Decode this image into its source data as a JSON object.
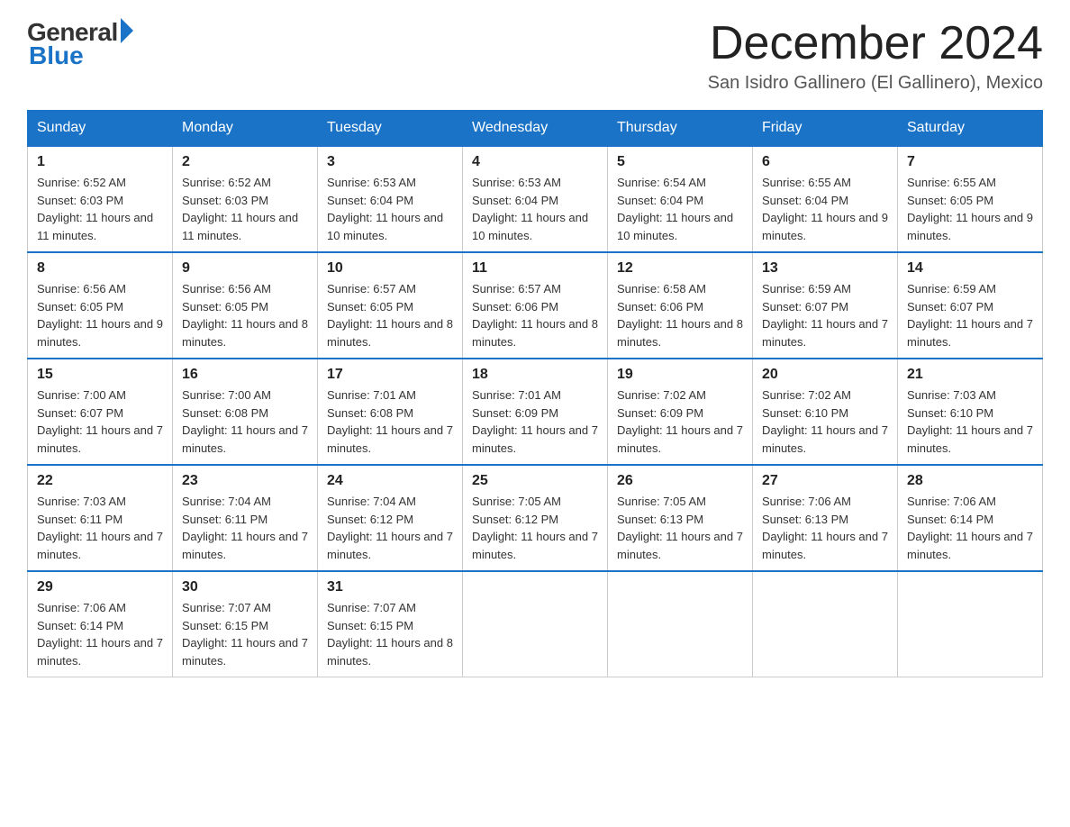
{
  "header": {
    "logo_general": "General",
    "logo_blue": "Blue",
    "month_year": "December 2024",
    "location": "San Isidro Gallinero (El Gallinero), Mexico"
  },
  "days_of_week": [
    "Sunday",
    "Monday",
    "Tuesday",
    "Wednesday",
    "Thursday",
    "Friday",
    "Saturday"
  ],
  "weeks": [
    [
      {
        "day": "1",
        "sunrise": "6:52 AM",
        "sunset": "6:03 PM",
        "daylight": "11 hours and 11 minutes."
      },
      {
        "day": "2",
        "sunrise": "6:52 AM",
        "sunset": "6:03 PM",
        "daylight": "11 hours and 11 minutes."
      },
      {
        "day": "3",
        "sunrise": "6:53 AM",
        "sunset": "6:04 PM",
        "daylight": "11 hours and 10 minutes."
      },
      {
        "day": "4",
        "sunrise": "6:53 AM",
        "sunset": "6:04 PM",
        "daylight": "11 hours and 10 minutes."
      },
      {
        "day": "5",
        "sunrise": "6:54 AM",
        "sunset": "6:04 PM",
        "daylight": "11 hours and 10 minutes."
      },
      {
        "day": "6",
        "sunrise": "6:55 AM",
        "sunset": "6:04 PM",
        "daylight": "11 hours and 9 minutes."
      },
      {
        "day": "7",
        "sunrise": "6:55 AM",
        "sunset": "6:05 PM",
        "daylight": "11 hours and 9 minutes."
      }
    ],
    [
      {
        "day": "8",
        "sunrise": "6:56 AM",
        "sunset": "6:05 PM",
        "daylight": "11 hours and 9 minutes."
      },
      {
        "day": "9",
        "sunrise": "6:56 AM",
        "sunset": "6:05 PM",
        "daylight": "11 hours and 8 minutes."
      },
      {
        "day": "10",
        "sunrise": "6:57 AM",
        "sunset": "6:05 PM",
        "daylight": "11 hours and 8 minutes."
      },
      {
        "day": "11",
        "sunrise": "6:57 AM",
        "sunset": "6:06 PM",
        "daylight": "11 hours and 8 minutes."
      },
      {
        "day": "12",
        "sunrise": "6:58 AM",
        "sunset": "6:06 PM",
        "daylight": "11 hours and 8 minutes."
      },
      {
        "day": "13",
        "sunrise": "6:59 AM",
        "sunset": "6:07 PM",
        "daylight": "11 hours and 7 minutes."
      },
      {
        "day": "14",
        "sunrise": "6:59 AM",
        "sunset": "6:07 PM",
        "daylight": "11 hours and 7 minutes."
      }
    ],
    [
      {
        "day": "15",
        "sunrise": "7:00 AM",
        "sunset": "6:07 PM",
        "daylight": "11 hours and 7 minutes."
      },
      {
        "day": "16",
        "sunrise": "7:00 AM",
        "sunset": "6:08 PM",
        "daylight": "11 hours and 7 minutes."
      },
      {
        "day": "17",
        "sunrise": "7:01 AM",
        "sunset": "6:08 PM",
        "daylight": "11 hours and 7 minutes."
      },
      {
        "day": "18",
        "sunrise": "7:01 AM",
        "sunset": "6:09 PM",
        "daylight": "11 hours and 7 minutes."
      },
      {
        "day": "19",
        "sunrise": "7:02 AM",
        "sunset": "6:09 PM",
        "daylight": "11 hours and 7 minutes."
      },
      {
        "day": "20",
        "sunrise": "7:02 AM",
        "sunset": "6:10 PM",
        "daylight": "11 hours and 7 minutes."
      },
      {
        "day": "21",
        "sunrise": "7:03 AM",
        "sunset": "6:10 PM",
        "daylight": "11 hours and 7 minutes."
      }
    ],
    [
      {
        "day": "22",
        "sunrise": "7:03 AM",
        "sunset": "6:11 PM",
        "daylight": "11 hours and 7 minutes."
      },
      {
        "day": "23",
        "sunrise": "7:04 AM",
        "sunset": "6:11 PM",
        "daylight": "11 hours and 7 minutes."
      },
      {
        "day": "24",
        "sunrise": "7:04 AM",
        "sunset": "6:12 PM",
        "daylight": "11 hours and 7 minutes."
      },
      {
        "day": "25",
        "sunrise": "7:05 AM",
        "sunset": "6:12 PM",
        "daylight": "11 hours and 7 minutes."
      },
      {
        "day": "26",
        "sunrise": "7:05 AM",
        "sunset": "6:13 PM",
        "daylight": "11 hours and 7 minutes."
      },
      {
        "day": "27",
        "sunrise": "7:06 AM",
        "sunset": "6:13 PM",
        "daylight": "11 hours and 7 minutes."
      },
      {
        "day": "28",
        "sunrise": "7:06 AM",
        "sunset": "6:14 PM",
        "daylight": "11 hours and 7 minutes."
      }
    ],
    [
      {
        "day": "29",
        "sunrise": "7:06 AM",
        "sunset": "6:14 PM",
        "daylight": "11 hours and 7 minutes."
      },
      {
        "day": "30",
        "sunrise": "7:07 AM",
        "sunset": "6:15 PM",
        "daylight": "11 hours and 7 minutes."
      },
      {
        "day": "31",
        "sunrise": "7:07 AM",
        "sunset": "6:15 PM",
        "daylight": "11 hours and 8 minutes."
      },
      null,
      null,
      null,
      null
    ]
  ]
}
